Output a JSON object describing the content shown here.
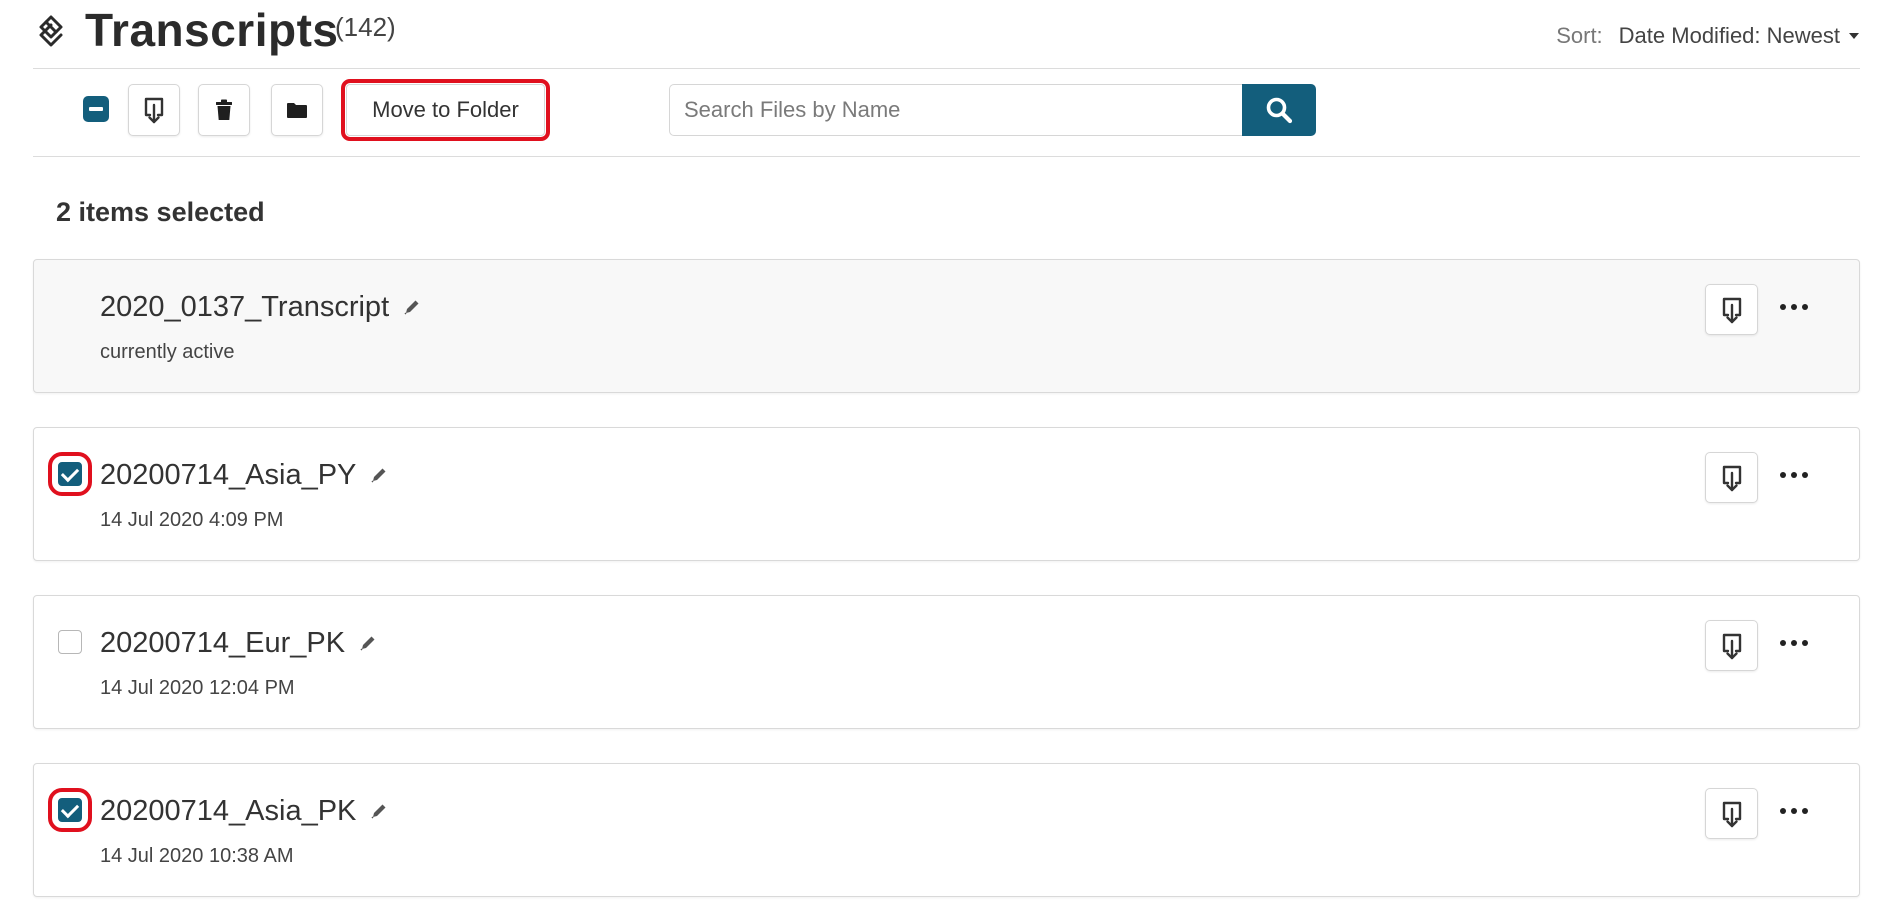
{
  "header": {
    "title": "Transcripts",
    "count": "(142)",
    "logo_icon": "transcript-logo-icon",
    "sort": {
      "label": "Sort:",
      "value": "Date Modified: Newest",
      "caret_icon": "caret-down-icon"
    }
  },
  "toolbar": {
    "select_all_state": "indeterminate",
    "download_icon": "download-icon",
    "delete_icon": "trash-icon",
    "folder_icon": "folder-icon",
    "move_to_folder_label": "Move to Folder",
    "search": {
      "placeholder": "Search Files by Name",
      "value": "",
      "button_icon": "search-icon"
    }
  },
  "selection": {
    "status": "2 items selected"
  },
  "files": [
    {
      "name": "2020_0137_Transcript",
      "meta": "currently active",
      "active": true,
      "checked": false,
      "show_checkbox": false
    },
    {
      "name": "20200714_Asia_PY",
      "meta": "14 Jul 2020 4:09 PM",
      "active": false,
      "checked": true,
      "show_checkbox": true
    },
    {
      "name": "20200714_Eur_PK",
      "meta": "14 Jul 2020 12:04 PM",
      "active": false,
      "checked": false,
      "show_checkbox": true
    },
    {
      "name": "20200714_Asia_PK",
      "meta": "14 Jul 2020 10:38 AM",
      "active": false,
      "checked": true,
      "show_checkbox": true
    }
  ],
  "colors": {
    "accent": "#135e7c",
    "highlight": "#e0101e",
    "border": "#d6d6d6",
    "text": "#333333"
  }
}
